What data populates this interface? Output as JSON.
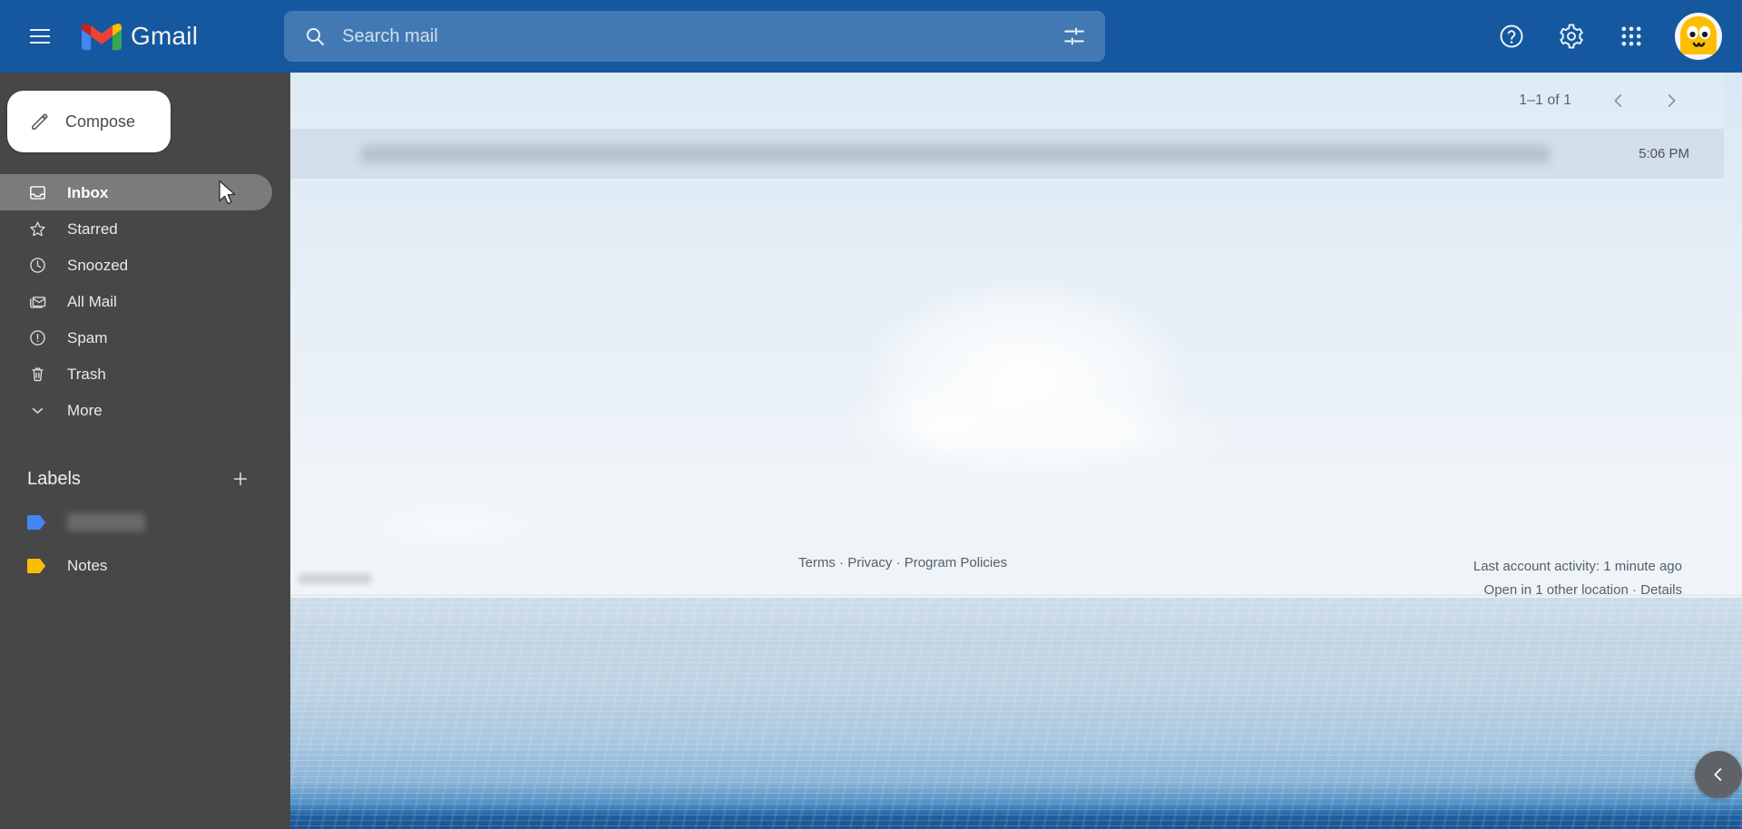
{
  "app": {
    "brand": "Gmail",
    "colors": {
      "header_blue": "#15589f",
      "sidebar_gray": "#474747",
      "active_item_gray": "#7b7b7b",
      "label_blue": "#4285f4",
      "label_yellow": "#fbbc04",
      "avatar_yellow": "#fdbe02"
    }
  },
  "header": {
    "menu_icon": "hamburger-icon",
    "logo_icon": "gmail-logo-icon",
    "title": "Gmail",
    "search": {
      "placeholder": "Search mail",
      "value": "",
      "search_icon": "search-icon",
      "filter_icon": "tune-filter-icon"
    },
    "actions": [
      {
        "name": "help-icon",
        "label": "Support"
      },
      {
        "name": "gear-icon",
        "label": "Settings"
      },
      {
        "name": "apps-grid-icon",
        "label": "Google apps"
      }
    ],
    "avatar": {
      "name": "avatar",
      "label": "Google Account"
    }
  },
  "sidebar": {
    "compose": {
      "label": "Compose",
      "icon": "pencil-icon"
    },
    "items": [
      {
        "label": "Inbox",
        "icon": "inbox-icon",
        "active": true
      },
      {
        "label": "Starred",
        "icon": "star-icon",
        "active": false
      },
      {
        "label": "Snoozed",
        "icon": "clock-icon",
        "active": false
      },
      {
        "label": "All Mail",
        "icon": "stacked-mail-icon",
        "active": false
      },
      {
        "label": "Spam",
        "icon": "exclamation-circle-icon",
        "active": false
      },
      {
        "label": "Trash",
        "icon": "trash-icon",
        "active": false
      },
      {
        "label": "More",
        "icon": "chevron-down-icon",
        "active": false
      }
    ],
    "labels_section": {
      "title": "Labels",
      "add_icon": "plus-icon",
      "items": [
        {
          "label": "",
          "redacted": true,
          "color": "#4285f4",
          "icon": "label-tag-icon"
        },
        {
          "label": "Notes",
          "redacted": false,
          "color": "#fbbc04",
          "icon": "label-tag-icon"
        }
      ]
    }
  },
  "main": {
    "toolbar": {
      "pagination": "1–1 of 1",
      "prev_icon": "chevron-left-icon",
      "next_icon": "chevron-right-icon"
    },
    "messages": [
      {
        "redacted": true,
        "time": "5:06 PM"
      }
    ]
  },
  "footer": {
    "links": [
      {
        "label": "Terms"
      },
      {
        "label": "Privacy"
      },
      {
        "label": "Program Policies"
      }
    ],
    "separator": " · ",
    "activity_line": "Last account activity: 1 minute ago",
    "location_prefix": "Open in 1 other location · ",
    "details_link": "Details"
  },
  "collapse_button": {
    "icon": "chevron-left-icon",
    "label": "Hide side panel"
  }
}
